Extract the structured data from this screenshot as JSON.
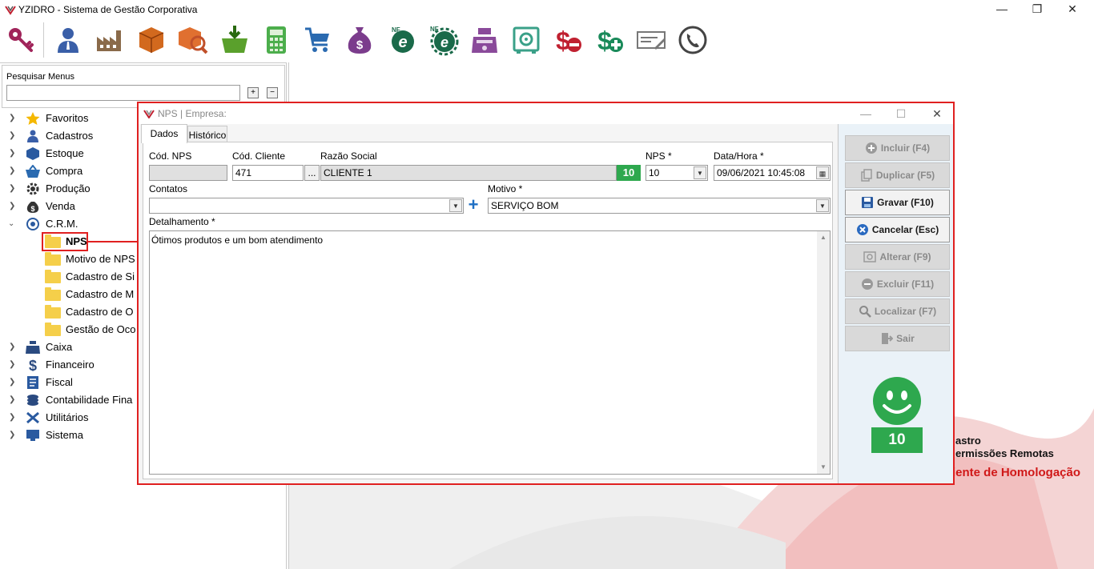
{
  "app": {
    "title": "YZIDRO - Sistema de Gestão Corporativa",
    "window_controls": {
      "minimize": "—",
      "maximize": "❐",
      "close": "✕"
    }
  },
  "toolbar": {
    "icons": [
      "key-icon",
      "user-icon",
      "factory-icon",
      "box-icon",
      "box-search-icon",
      "basket-download-icon",
      "calculator-icon",
      "cart-icon",
      "money-bag-icon",
      "nfe-icon",
      "nfse-icon",
      "cash-register-icon",
      "safe-icon",
      "dollar-minus-icon",
      "dollar-plus-icon",
      "check-pen-icon",
      "phone-icon"
    ]
  },
  "sidebar": {
    "search_label": "Pesquisar Menus",
    "search_value": "",
    "expand_label": "+",
    "collapse_label": "−",
    "items": [
      {
        "label": "Favoritos"
      },
      {
        "label": "Cadastros"
      },
      {
        "label": "Estoque"
      },
      {
        "label": "Compra"
      },
      {
        "label": "Produção"
      },
      {
        "label": "Venda"
      },
      {
        "label": "C.R.M."
      },
      {
        "label": "NPS"
      },
      {
        "label": "Motivo de NPS"
      },
      {
        "label": "Cadastro de Si"
      },
      {
        "label": "Cadastro de M"
      },
      {
        "label": "Cadastro de O"
      },
      {
        "label": "Gestão de Oco"
      },
      {
        "label": "Caixa"
      },
      {
        "label": "Financeiro"
      },
      {
        "label": "Fiscal"
      },
      {
        "label": "Contabilidade Fina"
      },
      {
        "label": "Utilitários"
      },
      {
        "label": "Sistema"
      }
    ]
  },
  "background": {
    "line1": "astro",
    "line2": "ermissões Remotas",
    "line3": "iente de Homologação"
  },
  "dialog": {
    "title": "NPS | Empresa:",
    "tabs": [
      {
        "label": "Dados"
      },
      {
        "label": "Histórico"
      }
    ],
    "fields": {
      "cod_nps": {
        "label": "Cód. NPS",
        "value": ""
      },
      "cod_cliente": {
        "label": "Cód. Cliente",
        "value": "471"
      },
      "ellipsis": "...",
      "razao_social": {
        "label": "Razão Social",
        "value": "CLIENTE 1",
        "score": "10"
      },
      "nps": {
        "label": "NPS *",
        "value": "10"
      },
      "data_hora": {
        "label": "Data/Hora *",
        "value": "09/06/2021 10:45:08"
      },
      "contatos": {
        "label": "Contatos",
        "value": ""
      },
      "motivo": {
        "label": "Motivo *",
        "value": "SERVIÇO BOM"
      },
      "detalhamento": {
        "label": "Detalhamento *",
        "value": "Ótimos produtos e um bom atendimento"
      }
    },
    "buttons": {
      "incluir": "Incluir (F4)",
      "duplicar": "Duplicar (F5)",
      "gravar": "Gravar (F10)",
      "cancelar": "Cancelar (Esc)",
      "alterar": "Alterar (F9)",
      "excluir": "Excluir (F11)",
      "localizar": "Localizar (F7)",
      "sair": "Sair"
    },
    "score": "10",
    "colors": {
      "accent_red": "#e02020",
      "score_green": "#2ea84e",
      "plus_blue": "#1e6fc4"
    }
  }
}
